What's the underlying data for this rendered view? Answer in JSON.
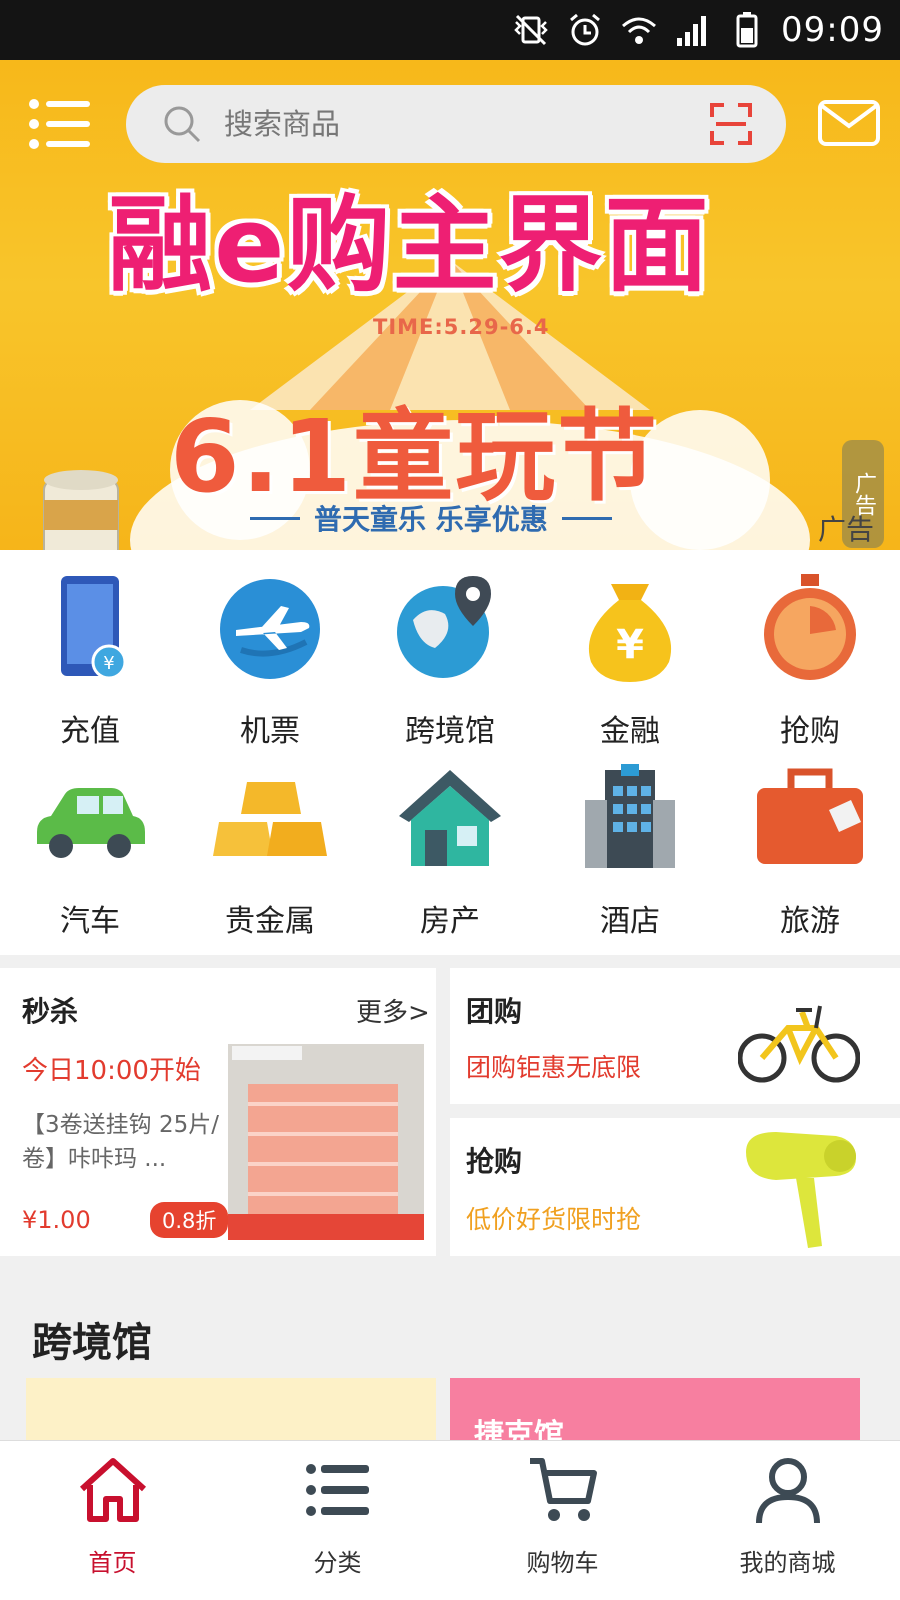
{
  "status_bar": {
    "time": "09:09"
  },
  "header": {
    "search_placeholder": "搜索商品",
    "overlay_title": "融e购主界面"
  },
  "banner": {
    "time": "TIME:5.29-6.4",
    "title": "6.1童玩节",
    "subtitle": "普天童乐 乐享优惠",
    "ad_tag": "广告",
    "ad_tag_2": "广告"
  },
  "categories": [
    {
      "label": "充值",
      "icon": "phone-recharge-icon"
    },
    {
      "label": "机票",
      "icon": "airplane-icon"
    },
    {
      "label": "跨境馆",
      "icon": "globe-location-icon"
    },
    {
      "label": "金融",
      "icon": "money-bag-icon"
    },
    {
      "label": "抢购",
      "icon": "stopwatch-icon"
    },
    {
      "label": "汽车",
      "icon": "car-icon"
    },
    {
      "label": "贵金属",
      "icon": "gold-bars-icon"
    },
    {
      "label": "房产",
      "icon": "house-icon"
    },
    {
      "label": "酒店",
      "icon": "hotel-icon"
    },
    {
      "label": "旅游",
      "icon": "suitcase-icon"
    }
  ],
  "flash_sale": {
    "title": "秒杀",
    "more": "更多>",
    "start_time": "今日10:00开始",
    "product_desc": "【3卷送挂钩 25片/卷】咔咔玛 ...",
    "price": "¥1.00",
    "discount": "0.8折"
  },
  "group_buy": {
    "title": "团购",
    "subtitle": "团购钜惠无底限"
  },
  "rush_buy": {
    "title": "抢购",
    "subtitle": "低价好货限时抢"
  },
  "cross_border": {
    "title": "跨境馆",
    "card2_text": "捷克馆"
  },
  "bottom_nav": [
    {
      "label": "首页",
      "icon": "home-icon",
      "active": true
    },
    {
      "label": "分类",
      "icon": "list-icon",
      "active": false
    },
    {
      "label": "购物车",
      "icon": "cart-icon",
      "active": false
    },
    {
      "label": "我的商城",
      "icon": "user-icon",
      "active": false
    }
  ],
  "colors": {
    "accent": "#c8102e",
    "banner": "#f7b81a",
    "price": "#e23b2e"
  }
}
